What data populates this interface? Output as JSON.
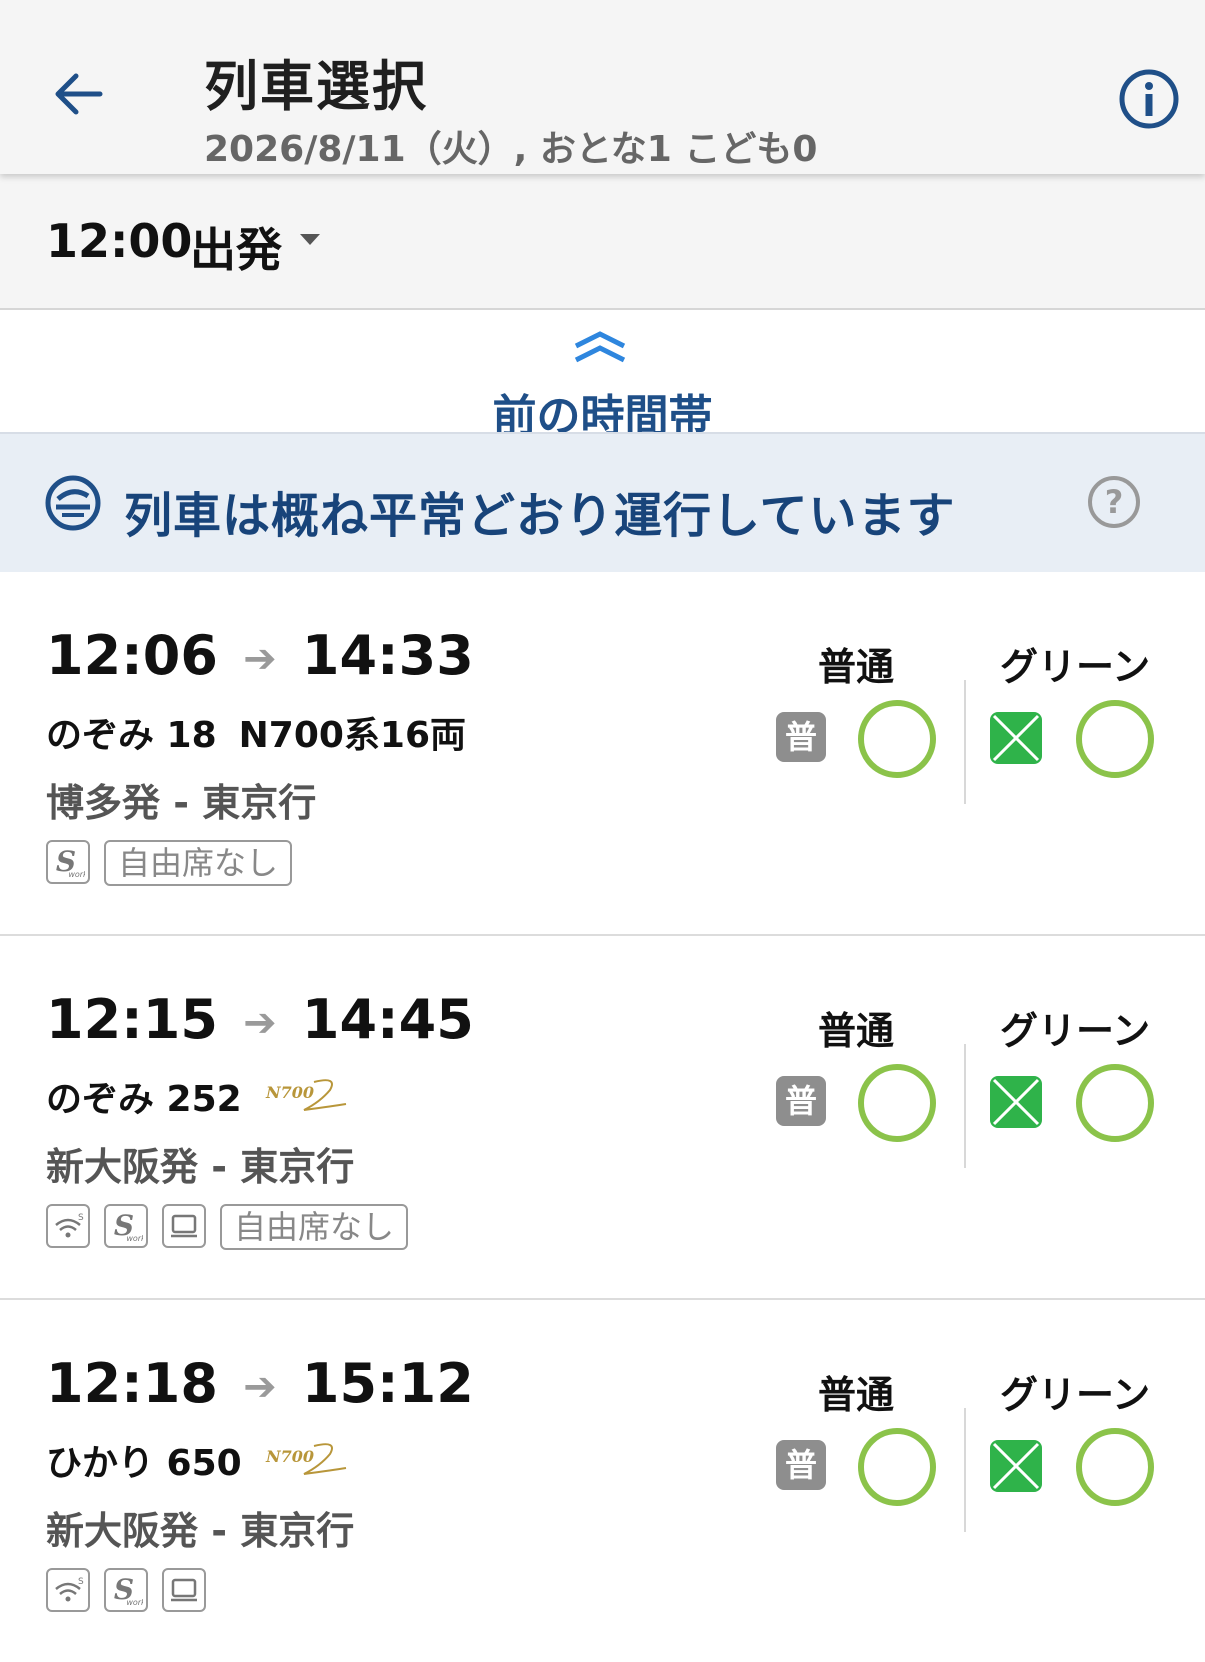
{
  "header": {
    "title": "列車選択",
    "subtitle": "2026/8/11（火）, おとな1 こども0"
  },
  "time_selector": {
    "time": "12:00",
    "mode": "出発"
  },
  "prev_period": {
    "label": "前の時間帯"
  },
  "status": {
    "text": "列車は概ね平常どおり運行しています"
  },
  "columns": {
    "normal": "普通",
    "green": "グリーン",
    "normal_icon": "普"
  },
  "trains": [
    {
      "depart": "12:06",
      "arrive": "14:33",
      "name": "のぞみ 18",
      "type_text": "N700系16両",
      "route": "博多発 - 東京行",
      "badge_text": "自由席なし",
      "normal_avail": "○",
      "green_avail": "○"
    },
    {
      "depart": "12:15",
      "arrive": "14:45",
      "name": "のぞみ 252",
      "route": "新大阪発 - 東京行",
      "badge_text": "自由席なし",
      "normal_avail": "○",
      "green_avail": "○"
    },
    {
      "depart": "12:18",
      "arrive": "15:12",
      "name": "ひかり 650",
      "route": "新大阪発 - 東京行",
      "normal_avail": "○",
      "green_avail": "○"
    }
  ],
  "colors": {
    "accent_blue": "#1f4f88",
    "available_green": "#8bc34a",
    "green_car": "#2fb34a"
  },
  "icons": [
    "back-arrow-icon",
    "info-icon",
    "caret-down-icon",
    "double-chevron-up-icon",
    "railway-logo-icon",
    "help-icon",
    "s-work-icon",
    "wifi-icon",
    "outlet-icon",
    "green-car-icon",
    "n700s-logo"
  ]
}
